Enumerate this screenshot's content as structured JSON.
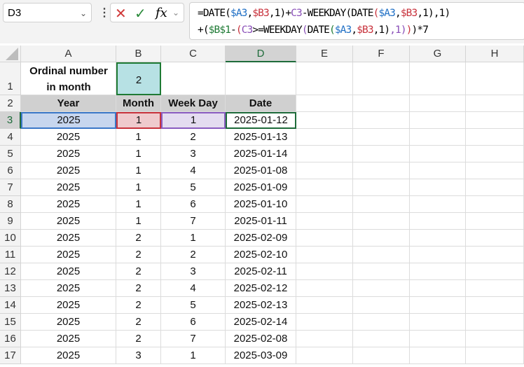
{
  "name_box": "D3",
  "formula_line1": [
    [
      "=DATE(",
      ""
    ],
    [
      "$A3",
      "cb"
    ],
    [
      ",",
      ""
    ],
    [
      "$B3",
      "cr"
    ],
    [
      ",1)+",
      ""
    ],
    [
      "C3",
      "cp"
    ],
    [
      "-WEEKDAY(DATE",
      ""
    ],
    [
      "(",
      "cr"
    ],
    [
      "$A3",
      "cb"
    ],
    [
      ",",
      ""
    ],
    [
      "$B3",
      "cr"
    ],
    [
      ",1)",
      ""
    ],
    [
      ",1)",
      ""
    ]
  ],
  "formula_line2": [
    [
      "+(",
      ""
    ],
    [
      "$B$1",
      "cg"
    ],
    [
      "-",
      ""
    ],
    [
      "(",
      "cr"
    ],
    [
      "C3",
      "cp"
    ],
    [
      ">=WEEKDAY",
      ""
    ],
    [
      "(",
      "cp"
    ],
    [
      "DATE",
      ""
    ],
    [
      "(",
      "cg"
    ],
    [
      "$A3",
      "cb"
    ],
    [
      ",",
      ""
    ],
    [
      "$B3",
      "cr"
    ],
    [
      ",1)",
      ""
    ],
    [
      ",1)",
      "cp"
    ],
    [
      ")",
      "cr"
    ],
    [
      ")*7",
      ""
    ]
  ],
  "columns": [
    "A",
    "B",
    "C",
    "D",
    "E",
    "F",
    "G",
    "H"
  ],
  "selected_column": "D",
  "selected_row": "3",
  "row1": {
    "label": "Ordinal number in month",
    "label_l1": "Ordinal number",
    "label_l2": "in month",
    "value": "2"
  },
  "headers": [
    "Year",
    "Month",
    "Week Day",
    "Date"
  ],
  "rows": [
    [
      "3",
      "2025",
      "1",
      "1",
      "2025-01-12"
    ],
    [
      "4",
      "2025",
      "1",
      "2",
      "2025-01-13"
    ],
    [
      "5",
      "2025",
      "1",
      "3",
      "2025-01-14"
    ],
    [
      "6",
      "2025",
      "1",
      "4",
      "2025-01-08"
    ],
    [
      "7",
      "2025",
      "1",
      "5",
      "2025-01-09"
    ],
    [
      "8",
      "2025",
      "1",
      "6",
      "2025-01-10"
    ],
    [
      "9",
      "2025",
      "1",
      "7",
      "2025-01-11"
    ],
    [
      "10",
      "2025",
      "2",
      "1",
      "2025-02-09"
    ],
    [
      "11",
      "2025",
      "2",
      "2",
      "2025-02-10"
    ],
    [
      "12",
      "2025",
      "2",
      "3",
      "2025-02-11"
    ],
    [
      "13",
      "2025",
      "2",
      "4",
      "2025-02-12"
    ],
    [
      "14",
      "2025",
      "2",
      "5",
      "2025-02-13"
    ],
    [
      "15",
      "2025",
      "2",
      "6",
      "2025-02-14"
    ],
    [
      "16",
      "2025",
      "2",
      "7",
      "2025-02-08"
    ],
    [
      "17",
      "2025",
      "3",
      "1",
      "2025-03-09"
    ]
  ]
}
